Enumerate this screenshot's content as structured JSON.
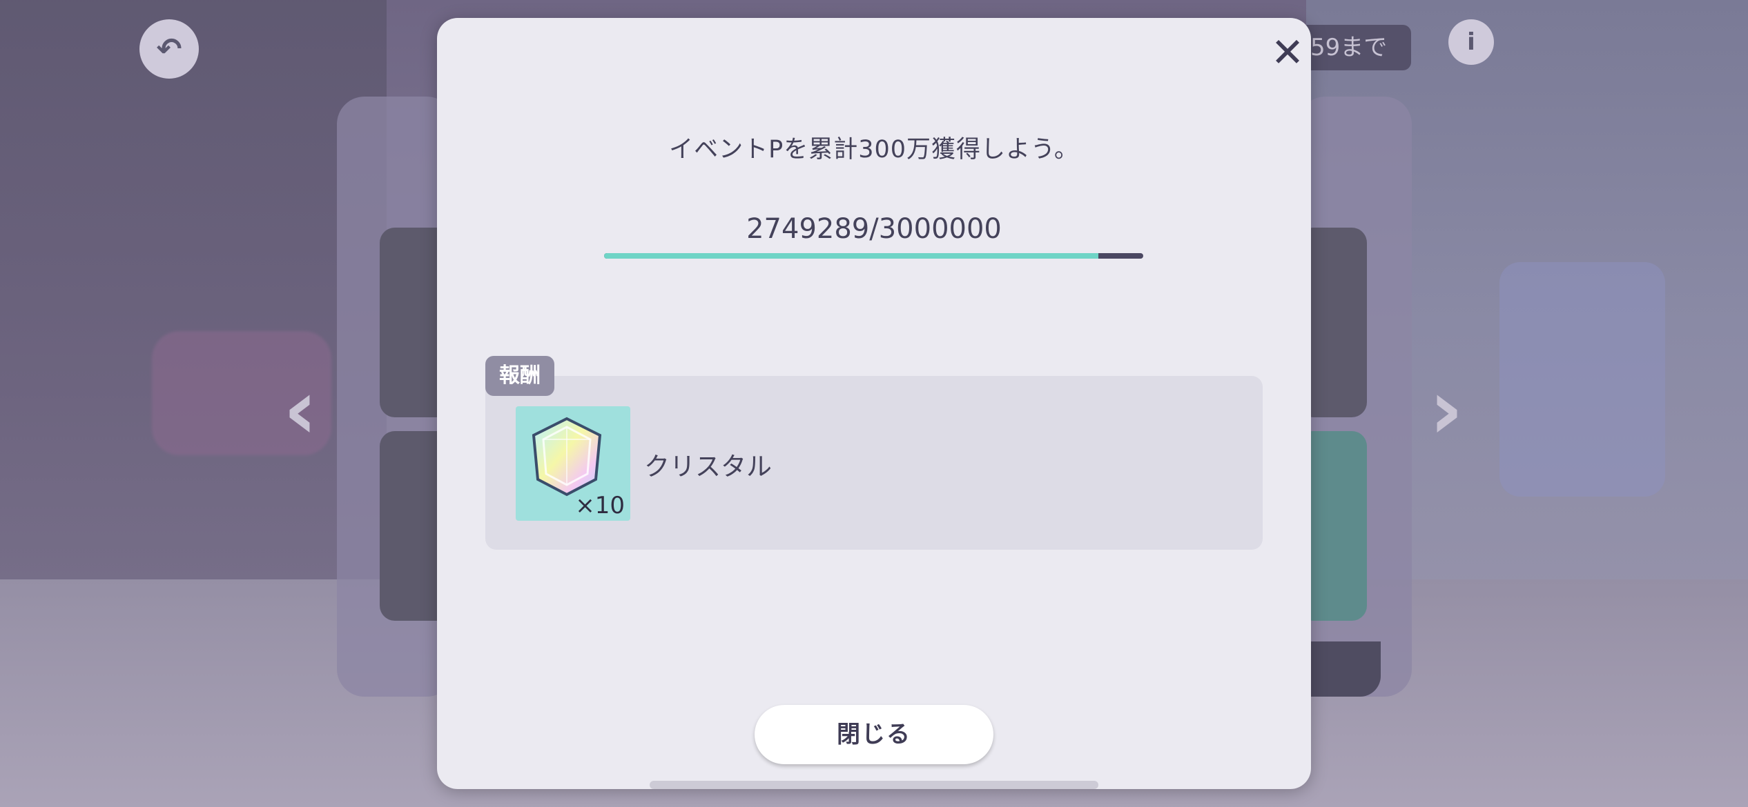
{
  "header": {
    "deadline_text": "59まで"
  },
  "modal": {
    "mission_text": "イベントPを累計300万獲得しよう。",
    "progress_text": "2749289/3000000",
    "progress_fraction": 0.9164,
    "reward_tag": "報酬",
    "reward_item": {
      "name": "クリスタル",
      "quantity": "×10",
      "icon": "crystal-icon"
    },
    "close_button_label": "閉じる",
    "close_icon": "close-icon"
  },
  "icons": {
    "back": "back-arrow-icon",
    "info": "info-icon",
    "nav_left": "chevron-left-icon",
    "nav_right": "chevron-right-icon"
  },
  "colors": {
    "progress_fill": "#6fd4c6",
    "progress_track": "#4b4862",
    "modal_bg": "#ebeaf1",
    "item_tile_bg": "#9fe0dd"
  }
}
